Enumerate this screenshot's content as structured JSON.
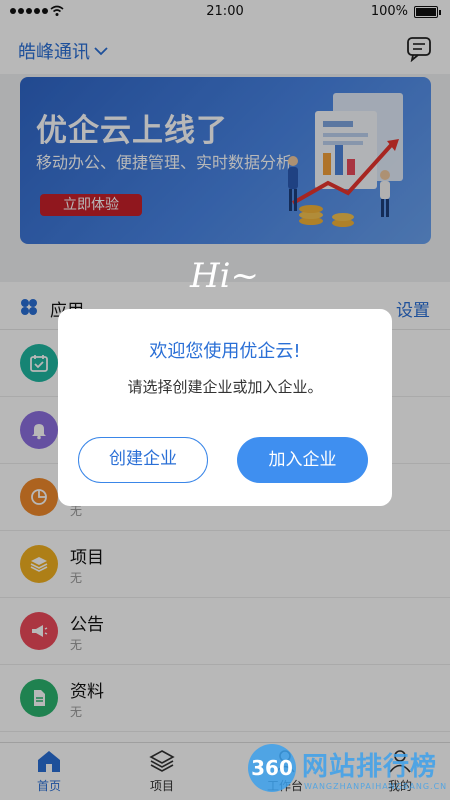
{
  "status_bar": {
    "time": "21:00",
    "battery": "100%"
  },
  "header": {
    "company_name": "皓峰通讯"
  },
  "banner": {
    "title": "优企云上线了",
    "subtitle": "移动办公、便捷管理、实时数据分析",
    "button_label": "立即体验"
  },
  "apps": {
    "title": "应用",
    "settings_label": "设置",
    "items": [
      {
        "name": "",
        "sub": "",
        "icon": "calendar-icon",
        "color": "#1fb7a1"
      },
      {
        "name": "",
        "sub": "",
        "icon": "bell-icon",
        "color": "#8d6fe0"
      },
      {
        "name": "",
        "sub": "无",
        "icon": "pie-chart-icon",
        "color": "#f08a2c"
      },
      {
        "name": "项目",
        "sub": "无",
        "icon": "layers-icon",
        "color": "#f2b020"
      },
      {
        "name": "公告",
        "sub": "无",
        "icon": "megaphone-icon",
        "color": "#ee4a5a"
      },
      {
        "name": "资料",
        "sub": "无",
        "icon": "document-icon",
        "color": "#2bb56f"
      }
    ]
  },
  "overlay": {
    "greeting": "Hi~"
  },
  "dialog": {
    "title": "欢迎您使用优企云!",
    "message": "请选择创建企业或加入企业。",
    "create_label": "创建企业",
    "join_label": "加入企业"
  },
  "tabbar": {
    "tabs": [
      {
        "label": "首页",
        "icon": "home-icon",
        "active": true
      },
      {
        "label": "项目",
        "icon": "layers-icon"
      },
      {
        "label": "工作台",
        "icon": "workbench-icon"
      },
      {
        "label": "我的",
        "icon": "user-icon"
      }
    ]
  },
  "watermark": {
    "badge": "360",
    "text": "网站排行榜",
    "small": "WANGZHANPAIHANGBANG.CN"
  },
  "colors": {
    "accent": "#2a6fd6",
    "primary_button": "#3f8ff0",
    "banner_button": "#c8202a"
  }
}
